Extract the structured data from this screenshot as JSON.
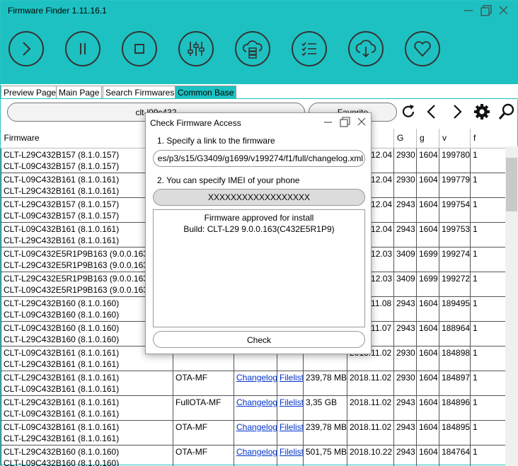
{
  "app": {
    "title": "Firmware Finder 1.11.16.1"
  },
  "tabs": [
    {
      "label": "Preview Page"
    },
    {
      "label": "Main Page"
    },
    {
      "label": "Search Firmwares"
    },
    {
      "label": "Common Base",
      "active": true
    }
  ],
  "search": {
    "value": "clt-l09c432"
  },
  "favorite_label": "Favorite",
  "toolbar_icons": [
    "play-icon",
    "pause-icon",
    "stop-icon",
    "sliders-icon",
    "cloud-server-icon",
    "checklist-icon",
    "cloud-download-icon",
    "heart-icon"
  ],
  "nav_icons": [
    "refresh-icon",
    "back-icon",
    "forward-icon",
    "settings-icon",
    "search-icon"
  ],
  "columns": [
    "Firmware",
    "",
    "",
    "",
    "",
    "",
    "G",
    "g",
    "v",
    "f"
  ],
  "rows": [
    {
      "firmware": [
        "CLT-L29C432B157 (8.1.0.157)",
        "CLT-L09C432B157 (8.1.0.157)"
      ],
      "type": "",
      "changelog": "",
      "filelist": "",
      "size": "",
      "date": "2018.12.04",
      "G": "2930",
      "g": "1604",
      "v": "199780",
      "f": "1"
    },
    {
      "firmware": [
        "CLT-L09C432B161 (8.1.0.161)",
        "CLT-L29C432B161 (8.1.0.161)"
      ],
      "type": "",
      "changelog": "",
      "filelist": "",
      "size": "",
      "date": "2018.12.04",
      "G": "2930",
      "g": "1604",
      "v": "199779",
      "f": "1"
    },
    {
      "firmware": [
        "CLT-L29C432B157 (8.1.0.157)",
        "CLT-L09C432B157 (8.1.0.157)"
      ],
      "type": "",
      "changelog": "",
      "filelist": "",
      "size": "",
      "date": "2018.12.04",
      "G": "2943",
      "g": "1604",
      "v": "199754",
      "f": "1"
    },
    {
      "firmware": [
        "CLT-L09C432B161 (8.1.0.161)",
        "CLT-L29C432B161 (8.1.0.161)"
      ],
      "type": "",
      "changelog": "",
      "filelist": "",
      "size": "",
      "date": "2018.12.04",
      "G": "2943",
      "g": "1604",
      "v": "199753",
      "f": "1"
    },
    {
      "firmware": [
        "CLT-L09C432E5R1P9B163 (9.0.0.163)",
        "CLT-L29C432E5R1P9B163 (9.0.0.163)"
      ],
      "type": "",
      "changelog": "",
      "filelist": "",
      "size": "",
      "date": "2018.12.03",
      "G": "3409",
      "g": "1699",
      "v": "199274",
      "f": "1"
    },
    {
      "firmware": [
        "CLT-L29C432E5R1P9B163 (9.0.0.163)",
        "CLT-L09C432E5R1P9B163 (9.0.0.163)"
      ],
      "type": "",
      "changelog": "",
      "filelist": "",
      "size": "",
      "date": "2018.12.03",
      "G": "3409",
      "g": "1699",
      "v": "199272",
      "f": "1"
    },
    {
      "firmware": [
        "CLT-L29C432B160 (8.1.0.160)",
        "CLT-L09C432B160 (8.1.0.160)"
      ],
      "type": "",
      "changelog": "",
      "filelist": "",
      "size": "",
      "date": "2018.11.08",
      "G": "2943",
      "g": "1604",
      "v": "189495",
      "f": "1"
    },
    {
      "firmware": [
        "CLT-L09C432B160 (8.1.0.160)",
        "CLT-L29C432B160 (8.1.0.160)"
      ],
      "type": "",
      "changelog": "",
      "filelist": "",
      "size": "",
      "date": "2018.11.07",
      "G": "2943",
      "g": "1604",
      "v": "188964",
      "f": "1"
    },
    {
      "firmware": [
        "CLT-L09C432B161 (8.1.0.161)",
        "CLT-L29C432B161 (8.1.0.161)"
      ],
      "type": "",
      "changelog": "",
      "filelist": "",
      "size": "",
      "date": "2018.11.02",
      "G": "2930",
      "g": "1604",
      "v": "184898",
      "f": "1"
    },
    {
      "firmware": [
        "CLT-L29C432B161 (8.1.0.161)",
        "CLT-L09C432B161 (8.1.0.161)"
      ],
      "type": "OTA-MF",
      "changelog": "Changelog",
      "filelist": "Filelist",
      "size": "239,78 MB",
      "date": "2018.11.02",
      "G": "2930",
      "g": "1604",
      "v": "184897",
      "f": "1"
    },
    {
      "firmware": [
        "CLT-L29C432B161 (8.1.0.161)",
        "CLT-L09C432B161 (8.1.0.161)"
      ],
      "type": "FullOTA-MF",
      "changelog": "Changelog",
      "filelist": "Filelist",
      "size": "3,35 GB",
      "date": "2018.11.02",
      "G": "2943",
      "g": "1604",
      "v": "184896",
      "f": "1"
    },
    {
      "firmware": [
        "CLT-L09C432B161 (8.1.0.161)",
        "CLT-L29C432B161 (8.1.0.161)"
      ],
      "type": "OTA-MF",
      "changelog": "Changelog",
      "filelist": "Filelist",
      "size": "239,78 MB",
      "date": "2018.11.02",
      "G": "2943",
      "g": "1604",
      "v": "184895",
      "f": "1"
    },
    {
      "firmware": [
        "CLT-L29C432B160 (8.1.0.160)",
        "CLT-L09C432B160 (8.1.0.160)"
      ],
      "type": "OTA-MF",
      "changelog": "Changelog",
      "filelist": "Filelist",
      "size": "501,75 MB",
      "date": "2018.10.22",
      "G": "2943",
      "g": "1604",
      "v": "184764",
      "f": "1"
    }
  ],
  "dialog": {
    "title": "Check Firmware Access",
    "step1": "1. Specify a link to the firmware",
    "url": "es/p3/s15/G3409/g1699/v199274/f1/full/changelog.xml",
    "step2": "2. You can specify IMEI of your phone",
    "imei": "XXXXXXXXXXXXXXXXXX",
    "result_line1": "Firmware approved for install",
    "result_line2": "Build: CLT-L29 9.0.0.163(C432E5R1P9)",
    "check_label": "Check"
  }
}
